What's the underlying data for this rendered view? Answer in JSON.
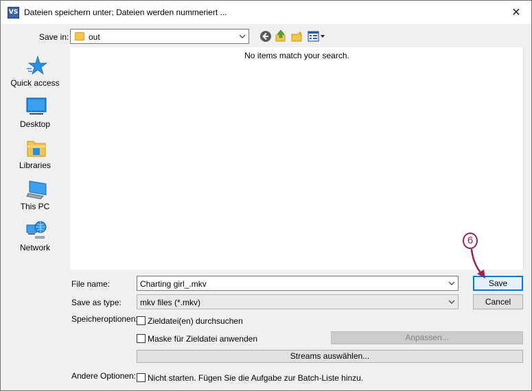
{
  "window": {
    "title": "Dateien speichern unter; Dateien werden nummeriert ...",
    "app_icon_text": "VS",
    "close_glyph": "✕"
  },
  "toolbar": {
    "save_in_label": "Save in:",
    "save_in_value": "out",
    "icons": [
      "back-icon",
      "up-folder-icon",
      "new-folder-icon",
      "view-menu-icon"
    ]
  },
  "places": [
    {
      "label": "Quick access",
      "icon": "star-icon"
    },
    {
      "label": "Desktop",
      "icon": "desktop-icon"
    },
    {
      "label": "Libraries",
      "icon": "libraries-icon"
    },
    {
      "label": "This PC",
      "icon": "computer-icon"
    },
    {
      "label": "Network",
      "icon": "network-icon"
    }
  ],
  "filelist": {
    "empty_message": "No items match your search."
  },
  "form": {
    "file_name_label": "File name:",
    "file_name_value": "Charting girl_.mkv",
    "save_as_type_label": "Save as type:",
    "save_as_type_value": "mkv files (*.mkv)",
    "speicheroptionen_label": "Speicheroptionen:",
    "option_zieldatei_durchsuchen": "Zieldatei(en) durchsuchen",
    "option_maske": "Maske für Zieldatei anwenden",
    "anpassen_label": "Anpassen...",
    "streams_label": "Streams auswählen...",
    "andere_optionen_label": "Andere Optionen:",
    "option_nicht_starten": "Nicht starten. Fügen Sie die Aufgabe zur Batch-Liste hinzu."
  },
  "buttons": {
    "save": "Save",
    "cancel": "Cancel"
  },
  "annotation": {
    "step_number": "6",
    "color": "#9c1f5a"
  },
  "colors": {
    "accent": "#0078d7",
    "dialog_bg": "#f0f0f0"
  }
}
